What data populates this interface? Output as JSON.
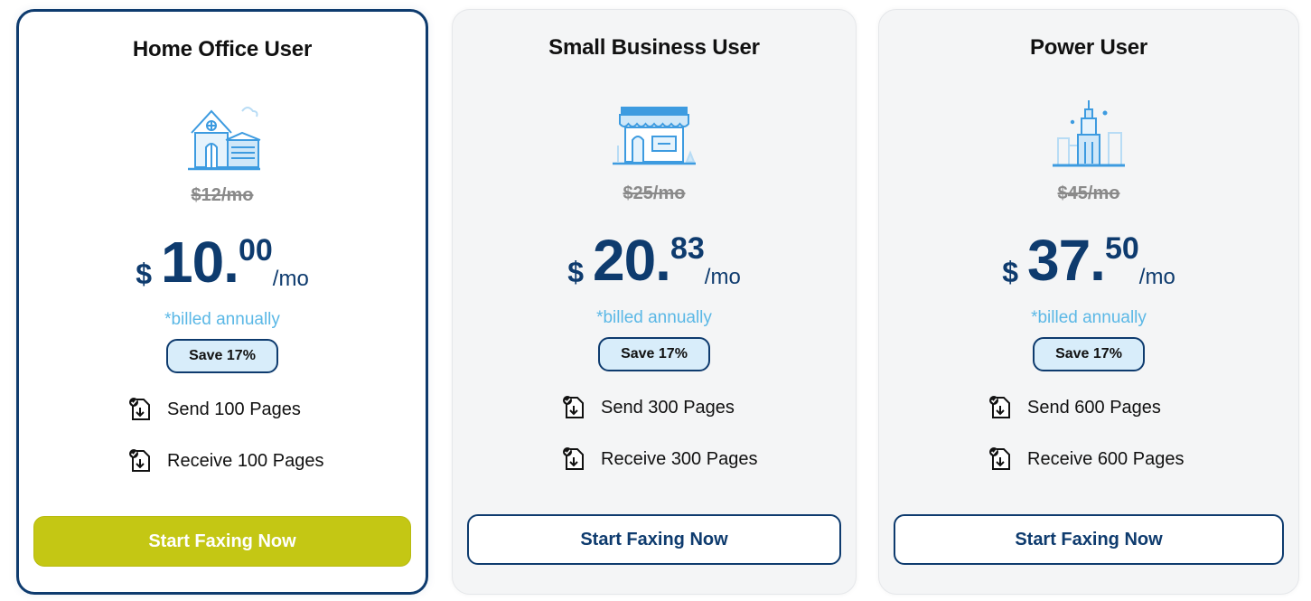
{
  "colors": {
    "brand_navy": "#0e3b6e",
    "accent_lime": "#c4c714",
    "billed_blue": "#5bb8e6",
    "badge_bg": "#d8edfa",
    "icon_blue": "#3d9be0"
  },
  "plans": [
    {
      "title": "Home Office User",
      "icon": "house-icon",
      "old_price": "$12/mo",
      "currency": "$",
      "price_whole": "10.",
      "price_cents": "00",
      "price_period": "/mo",
      "billing_note": "*billed annually",
      "save_badge": "Save 17%",
      "features": [
        {
          "icon": "fax-document-icon",
          "text": "Send 100 Pages"
        },
        {
          "icon": "fax-document-icon",
          "text": "Receive 100 Pages"
        }
      ],
      "cta_label": "Start Faxing Now",
      "featured": true
    },
    {
      "title": "Small Business User",
      "icon": "storefront-icon",
      "old_price": "$25/mo",
      "currency": "$",
      "price_whole": "20.",
      "price_cents": "83",
      "price_period": "/mo",
      "billing_note": "*billed annually",
      "save_badge": "Save 17%",
      "features": [
        {
          "icon": "fax-document-icon",
          "text": "Send 300 Pages"
        },
        {
          "icon": "fax-document-icon",
          "text": "Receive 300 Pages"
        }
      ],
      "cta_label": "Start Faxing Now",
      "featured": false
    },
    {
      "title": "Power User",
      "icon": "skyscraper-icon",
      "old_price": "$45/mo",
      "currency": "$",
      "price_whole": "37.",
      "price_cents": "50",
      "price_period": "/mo",
      "billing_note": "*billed annually",
      "save_badge": "Save 17%",
      "features": [
        {
          "icon": "fax-document-icon",
          "text": "Send 600 Pages"
        },
        {
          "icon": "fax-document-icon",
          "text": "Receive 600 Pages"
        }
      ],
      "cta_label": "Start Faxing Now",
      "featured": false
    }
  ]
}
